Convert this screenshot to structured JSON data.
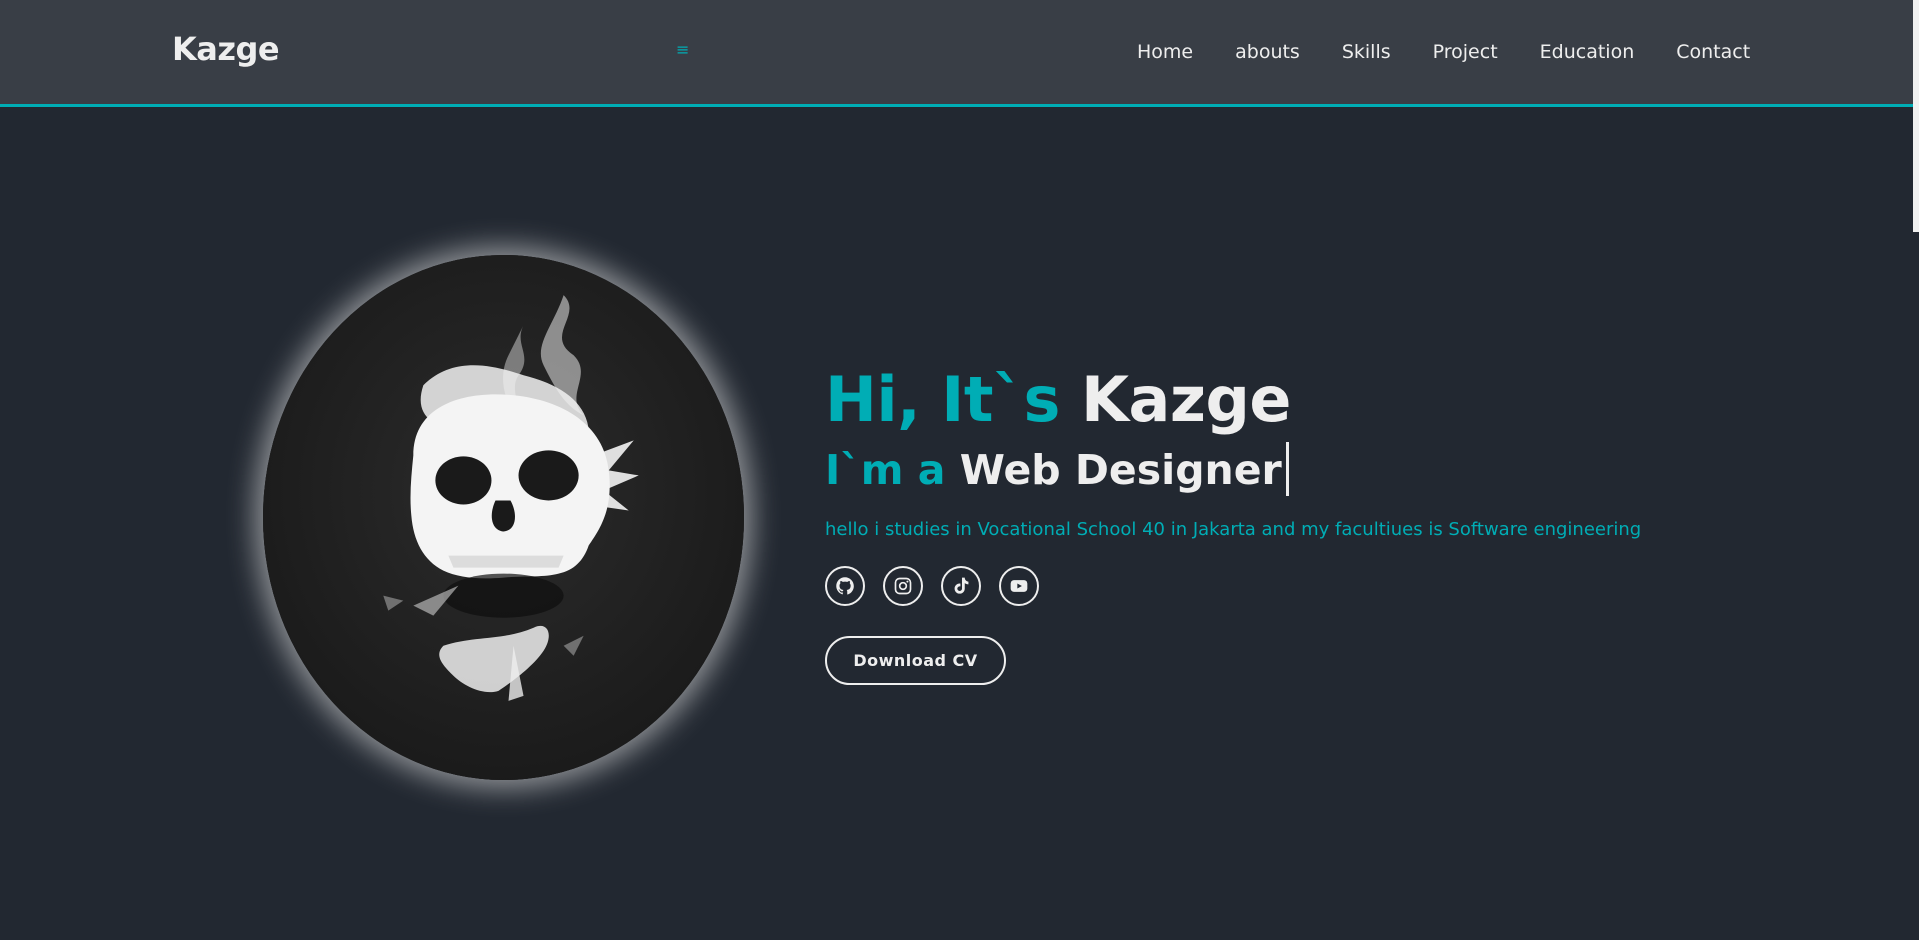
{
  "header": {
    "logo": "Kazge",
    "menu_toggle": "≡",
    "nav": [
      "Home",
      "abouts",
      "Skills",
      "Project",
      "Education",
      "Contact"
    ]
  },
  "hero": {
    "greeting_accent": "Hi, It`s",
    "name": "Kazge",
    "role_prefix": "I`m a",
    "role": "Web Designer",
    "description": "hello i studies in Vocational School 40 in Jakarta and my facultiues is Software engineering",
    "socials": [
      "github-icon",
      "instagram-icon",
      "tiktok-icon",
      "youtube-icon"
    ],
    "cta_label": "Download CV"
  },
  "colors": {
    "background": "#222831",
    "header": "#393e46",
    "accent": "#00adb5",
    "text": "#eeeeee"
  }
}
